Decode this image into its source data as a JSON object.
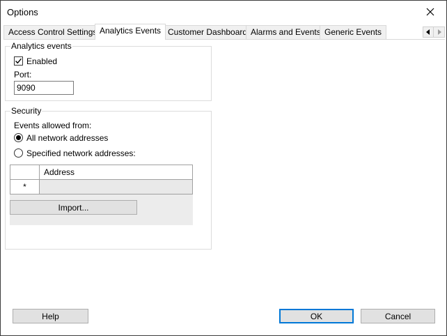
{
  "window": {
    "title": "Options"
  },
  "tabs": [
    {
      "label": "Access Control Settings"
    },
    {
      "label": "Analytics Events"
    },
    {
      "label": "Customer Dashboard"
    },
    {
      "label": "Alarms and Events"
    },
    {
      "label": "Generic Events"
    }
  ],
  "analytics": {
    "group_label": "Analytics events",
    "enabled_label": "Enabled",
    "enabled_checked": true,
    "port_label": "Port:",
    "port_value": "9090"
  },
  "security": {
    "group_label": "Security",
    "events_allowed_label": "Events allowed from:",
    "option_all": "All network addresses",
    "option_specified": "Specified network addresses:",
    "selected": "all",
    "grid": {
      "column_header": "Address",
      "new_row_marker": "*",
      "rows": []
    },
    "import_label": "Import..."
  },
  "footer": {
    "help_label": "Help",
    "ok_label": "OK",
    "cancel_label": "Cancel"
  },
  "icons": {
    "close": "close-icon",
    "scroll_left": "chevron-left-icon",
    "scroll_right": "chevron-right-icon",
    "checkmark": "checkmark-icon"
  },
  "colors": {
    "accent": "#0078d7",
    "button_face": "#e1e1e1"
  }
}
